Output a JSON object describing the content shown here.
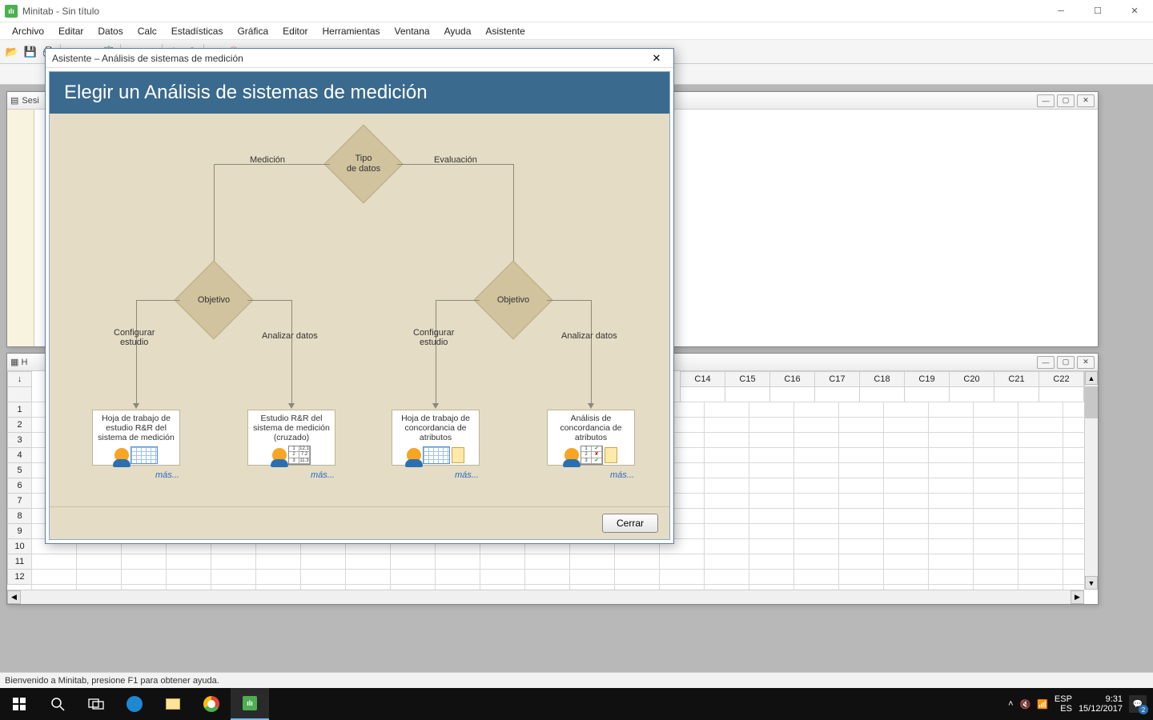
{
  "app": {
    "title": "Minitab - Sin título"
  },
  "menu": [
    "Archivo",
    "Editar",
    "Datos",
    "Calc",
    "Estadísticas",
    "Gráfica",
    "Editor",
    "Herramientas",
    "Ventana",
    "Ayuda",
    "Asistente"
  ],
  "session": {
    "title": "Sesi"
  },
  "worksheet": {
    "title": "H",
    "columns": [
      "C14",
      "C15",
      "C16",
      "C17",
      "C18",
      "C19",
      "C20",
      "C21",
      "C22"
    ],
    "rows": [
      "1",
      "2",
      "3",
      "4",
      "5",
      "6",
      "7",
      "8",
      "9",
      "10",
      "11",
      "12"
    ]
  },
  "ws_footer_hint": "...",
  "statusbar": "Bienvenido a Minitab, presione F1 para obtener ayuda.",
  "dialog": {
    "titlebar": "Asistente – Análisis de sistemas de medición",
    "heading": "Elegir un Análisis de sistemas de medición",
    "top_diamond": "Tipo\nde datos",
    "branch_left": "Medición",
    "branch_right": "Evaluación",
    "mid_diamond_left": "Objetivo",
    "mid_diamond_right": "Objetivo",
    "leaf_labels": {
      "l1": "Configurar\nestudio",
      "l2": "Analizar datos",
      "r1": "Configurar\nestudio",
      "r2": "Analizar datos"
    },
    "options": {
      "o1": "Hoja de trabajo de estudio R&R del sistema de medición",
      "o2": "Estudio R&R del sistema de medición (cruzado)",
      "o3": "Hoja de trabajo de concordancia de atributos",
      "o4": "Análisis de concordancia de atributos"
    },
    "more": "más...",
    "close_btn": "Cerrar"
  },
  "tray": {
    "lang_top": "ESP",
    "lang_bottom": "ES",
    "time": "9:31",
    "date": "15/12/2017",
    "notif_count": "2"
  }
}
